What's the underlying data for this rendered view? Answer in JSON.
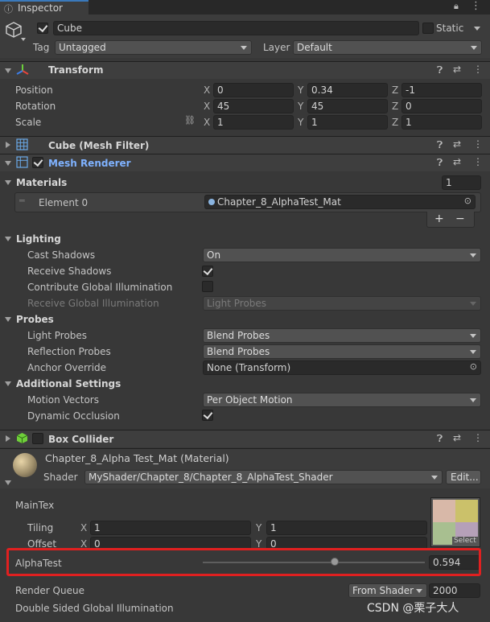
{
  "tab": {
    "title": "Inspector"
  },
  "object": {
    "enabled": true,
    "name": "Cube",
    "static_label": "Static",
    "tag_label": "Tag",
    "tag_value": "Untagged",
    "layer_label": "Layer",
    "layer_value": "Default"
  },
  "transform": {
    "title": "Transform",
    "rows": [
      {
        "label": "Position",
        "x": "0",
        "y": "0.34",
        "z": "-1"
      },
      {
        "label": "Rotation",
        "x": "45",
        "y": "45",
        "z": "0"
      },
      {
        "label": "Scale",
        "x": "1",
        "y": "1",
        "z": "1"
      }
    ],
    "axis": {
      "x": "X",
      "y": "Y",
      "z": "Z"
    }
  },
  "mesh_filter": {
    "title": "Cube (Mesh Filter)"
  },
  "mesh_renderer": {
    "title": "Mesh Renderer",
    "materials_label": "Materials",
    "materials_count": "1",
    "element_label": "Element 0",
    "element_value": "Chapter_8_AlphaTest_Mat",
    "add": "+",
    "remove": "−",
    "lighting": {
      "title": "Lighting",
      "cast_shadows_label": "Cast Shadows",
      "cast_shadows_value": "On",
      "receive_shadows_label": "Receive Shadows",
      "contribute_gi_label": "Contribute Global Illumination",
      "receive_gi_label": "Receive Global Illumination",
      "receive_gi_value": "Light Probes"
    },
    "probes": {
      "title": "Probes",
      "light_probes_label": "Light Probes",
      "light_probes_value": "Blend Probes",
      "reflection_probes_label": "Reflection Probes",
      "reflection_probes_value": "Blend Probes",
      "anchor_label": "Anchor Override",
      "anchor_value": "None (Transform)"
    },
    "additional": {
      "title": "Additional Settings",
      "motion_label": "Motion Vectors",
      "motion_value": "Per Object Motion",
      "occlusion_label": "Dynamic Occlusion"
    }
  },
  "box_collider": {
    "title": "Box Collider"
  },
  "material": {
    "title": "Chapter_8_Alpha Test_Mat (Material)",
    "shader_label": "Shader",
    "shader_value": "MyShader/Chapter_8/Chapter_8_AlphaTest_Shader",
    "edit": "Edit...",
    "maintex_label": "MainTex",
    "tiling_label": "Tiling",
    "tiling_x": "1",
    "tiling_y": "1",
    "offset_label": "Offset",
    "offset_x": "0",
    "offset_y": "0",
    "select": "Select",
    "alphatest_label": "AlphaTest",
    "alphatest_value": "0.594",
    "alphatest_fraction": 0.594,
    "render_queue_label": "Render Queue",
    "render_queue_mode": "From Shader",
    "render_queue_value": "2000",
    "double_sided_label": "Double Sided Global Illumination"
  },
  "watermark": "CSDN @栗子大人",
  "colors": {
    "highlight_box": "#e02020",
    "mesh_renderer_title": "#7fb2ff",
    "panel": "#383838",
    "header": "#3e3e3e"
  }
}
